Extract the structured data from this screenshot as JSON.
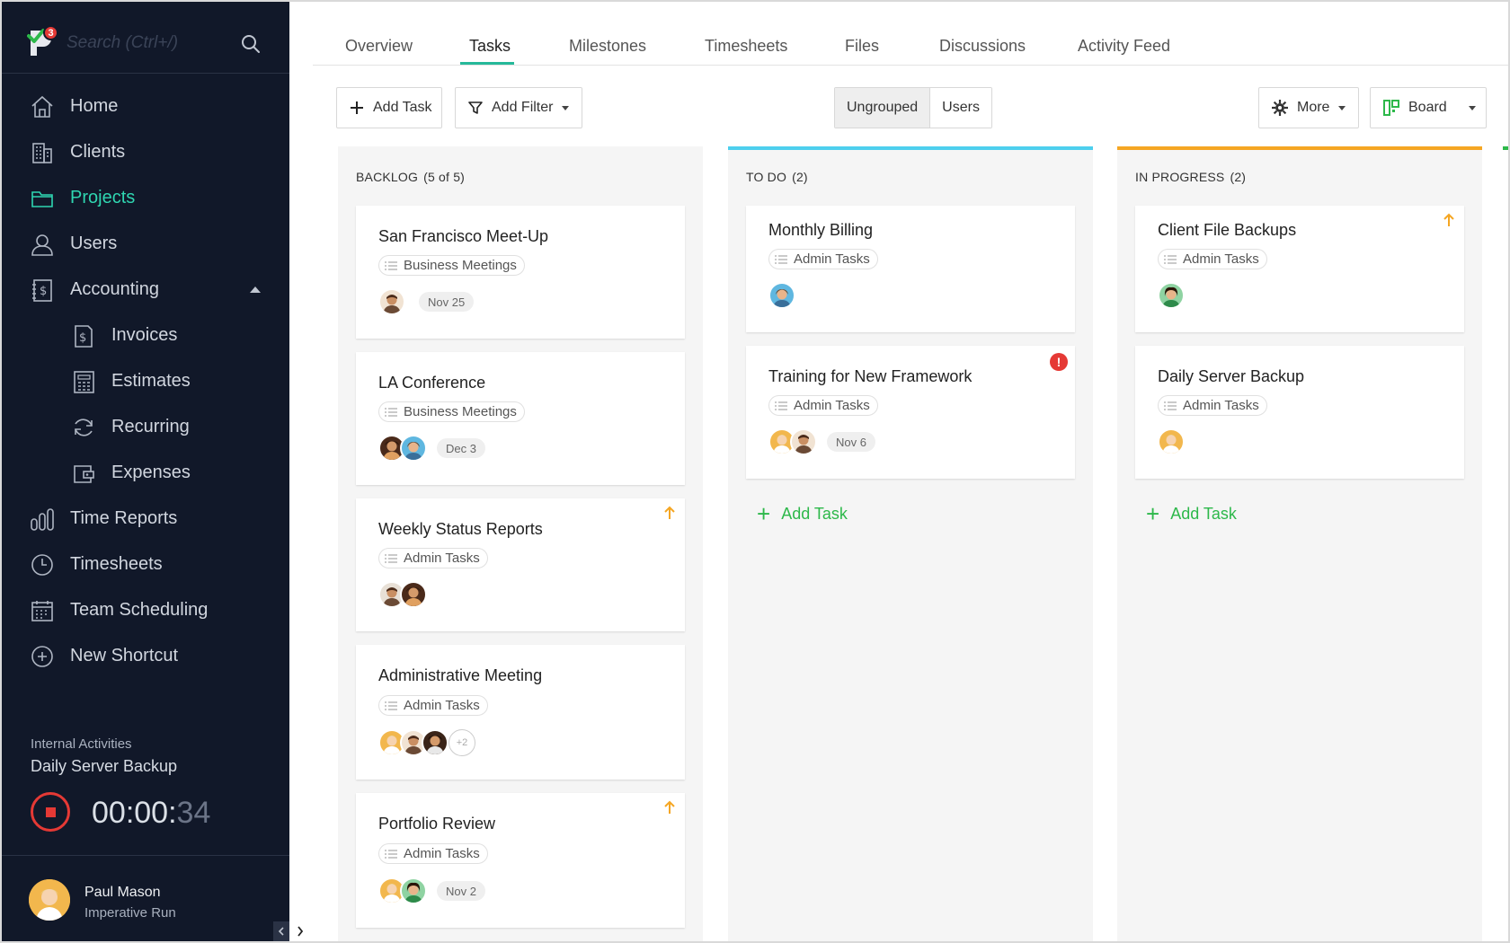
{
  "sidebar": {
    "logo_badge": "3",
    "search_placeholder": "Search (Ctrl+/)",
    "nav": [
      {
        "label": "Home",
        "icon": "home-icon"
      },
      {
        "label": "Clients",
        "icon": "building-icon"
      },
      {
        "label": "Projects",
        "icon": "folder-icon",
        "active": true
      },
      {
        "label": "Users",
        "icon": "user-icon"
      },
      {
        "label": "Accounting",
        "icon": "ledger-icon",
        "expanded": true
      },
      {
        "label": "Invoices",
        "icon": "dollar-doc-icon",
        "sub": true
      },
      {
        "label": "Estimates",
        "icon": "calculator-icon",
        "sub": true
      },
      {
        "label": "Recurring",
        "icon": "refresh-icon",
        "sub": true
      },
      {
        "label": "Expenses",
        "icon": "wallet-icon",
        "sub": true
      },
      {
        "label": "Time Reports",
        "icon": "bar-chart-icon"
      },
      {
        "label": "Timesheets",
        "icon": "clock-icon"
      },
      {
        "label": "Team Scheduling",
        "icon": "calendar-icon"
      },
      {
        "label": "New Shortcut",
        "icon": "plus-circle-icon"
      }
    ],
    "timer": {
      "caption": "Internal Activities",
      "task": "Daily Server Backup",
      "time_main": "00:00:",
      "time_seconds": "34"
    },
    "user": {
      "name": "Paul Mason",
      "org": "Imperative Run"
    }
  },
  "tabs": [
    {
      "label": "Overview"
    },
    {
      "label": "Tasks",
      "active": true
    },
    {
      "label": "Milestones"
    },
    {
      "label": "Timesheets"
    },
    {
      "label": "Files"
    },
    {
      "label": "Discussions"
    },
    {
      "label": "Activity Feed"
    }
  ],
  "toolbar": {
    "add_task": "Add Task",
    "add_filter": "Add Filter",
    "group_options": [
      "Ungrouped",
      "Users"
    ],
    "group_selected": "Ungrouped",
    "more": "More",
    "view": "Board"
  },
  "colors": {
    "accent": "#26b99a",
    "sidebar_bg": "#111829",
    "todo_bar": "#4dcfee",
    "in_progress_bar": "#f5a623",
    "add_green": "#2db84a",
    "alert_red": "#e53935"
  },
  "board": {
    "add_task_label": "Add Task",
    "columns": [
      {
        "title": "BACKLOG",
        "count": "(5 of 5)",
        "cards": [
          {
            "title": "San Francisco Meet-Up",
            "tag": "Business Meetings",
            "date": "Nov 25"
          },
          {
            "title": "LA Conference",
            "tag": "Business Meetings",
            "date": "Dec 3"
          },
          {
            "title": "Weekly Status Reports",
            "tag": "Admin Tasks",
            "priority": "high"
          },
          {
            "title": "Administrative Meeting",
            "tag": "Admin Tasks",
            "extra_assignees": "+2"
          },
          {
            "title": "Portfolio Review",
            "tag": "Admin Tasks",
            "date": "Nov 2",
            "priority": "high"
          }
        ]
      },
      {
        "title": "TO DO",
        "count": "(2)",
        "cards": [
          {
            "title": "Monthly Billing",
            "tag": "Admin Tasks"
          },
          {
            "title": "Training for New Framework",
            "tag": "Admin Tasks",
            "date": "Nov 6",
            "alert": "!"
          }
        ]
      },
      {
        "title": "IN PROGRESS",
        "count": "(2)",
        "cards": [
          {
            "title": "Client File Backups",
            "tag": "Admin Tasks",
            "priority": "high"
          },
          {
            "title": "Daily Server Backup",
            "tag": "Admin Tasks"
          }
        ]
      }
    ]
  }
}
